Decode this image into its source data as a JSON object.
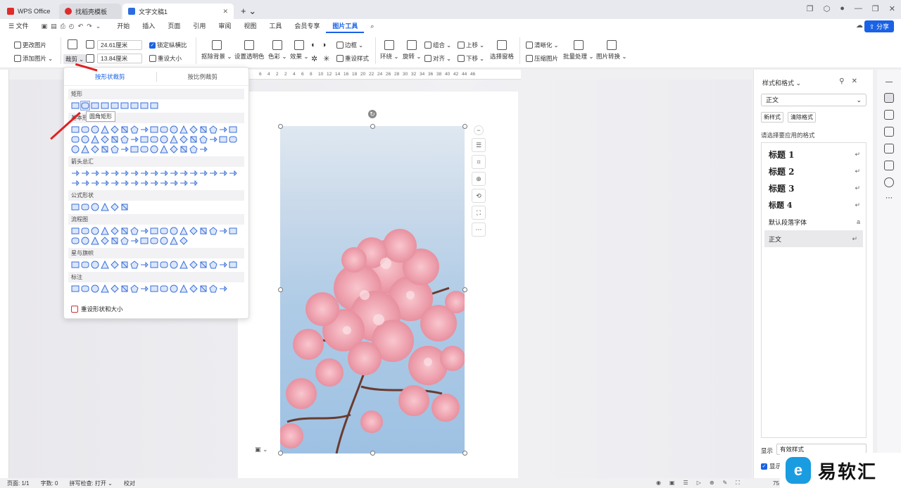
{
  "titlebar": {
    "tabs": [
      {
        "label": "WPS Office",
        "color": "#e02b2b"
      },
      {
        "label": "找稻壳模板",
        "color": "#e02b2b"
      },
      {
        "label": "文字文稿1",
        "color": "#2b6de0"
      }
    ]
  },
  "menu": {
    "file": "文件",
    "items": [
      "开始",
      "插入",
      "页面",
      "引用",
      "审阅",
      "视图",
      "工具",
      "会员专享",
      "图片工具"
    ],
    "active": "图片工具",
    "share": "分享"
  },
  "ribbon": {
    "change_pic": "更改图片",
    "add_pic": "添加图片",
    "crop": "裁剪",
    "width": "24.61厘米",
    "height": "13.84厘米",
    "lock_ratio": "锁定纵横比",
    "reset_size": "重设大小",
    "remove_bg": "抠除背景",
    "transparent": "设置透明色",
    "color": "色彩",
    "effect": "效果",
    "border": "边框",
    "reset_style": "重设样式",
    "wrap": "环绕",
    "rotate": "旋转",
    "group": "组合",
    "align": "对齐",
    "bring_up": "上移",
    "send_down": "下移",
    "select_pane": "选择窗格",
    "sharpen": "清晰化",
    "compress": "压缩图片",
    "batch": "批量处理",
    "convert": "图片转换"
  },
  "ruler": {
    "ticks": [
      "6",
      "4",
      "2",
      "2",
      "4",
      "6",
      "8",
      "10",
      "12",
      "14",
      "16",
      "18",
      "20",
      "22",
      "24",
      "26",
      "28",
      "30",
      "32",
      "34",
      "36",
      "38",
      "40",
      "42",
      "44",
      "46"
    ]
  },
  "dropdown": {
    "tab_shape": "按形状裁剪",
    "tab_ratio": "按比例裁剪",
    "cats": [
      "矩形",
      "基本形状",
      "箭头总汇",
      "公式形状",
      "流程图",
      "星与旗帜",
      "标注"
    ],
    "tooltip": "圆角矩形",
    "reset": "重设形状和大小"
  },
  "styles": {
    "title": "样式和格式",
    "current": "正文",
    "new_style": "新样式",
    "clear": "清除格式",
    "hint": "请选择要应用的格式",
    "list": [
      "标题 1",
      "标题 2",
      "标题 3",
      "标题 4",
      "默认段落字体",
      "正文"
    ],
    "display_label": "显示",
    "display_value": "有效样式",
    "show_preview": "显示"
  },
  "status": {
    "page": "页面: 1/1",
    "words": "字数: 0",
    "spell": "拼写检查: 打开",
    "proof": "校对",
    "zoom": "75"
  },
  "watermark": {
    "text": "易软汇"
  }
}
